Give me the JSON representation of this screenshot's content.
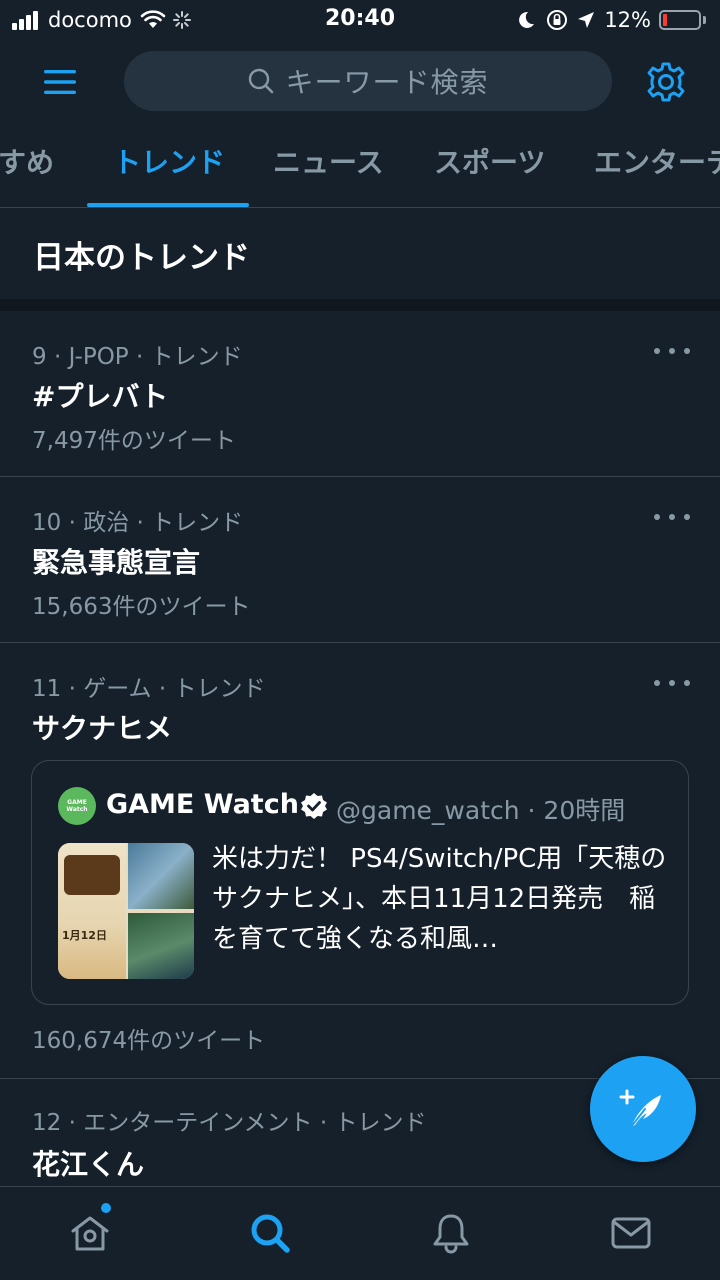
{
  "status_bar": {
    "carrier": "docomo",
    "time": "20:40",
    "battery_percent": "12%",
    "battery_level": 0.12,
    "icons": [
      "signal-icon",
      "wifi-icon",
      "activity-spinner-icon",
      "moon-icon",
      "rotation-lock-icon",
      "location-icon",
      "battery-icon"
    ]
  },
  "search": {
    "placeholder": "キーワード検索"
  },
  "tabs": [
    {
      "label": "すめ",
      "active": false
    },
    {
      "label": "トレンド",
      "active": true
    },
    {
      "label": "ニュース",
      "active": false
    },
    {
      "label": "スポーツ",
      "active": false
    },
    {
      "label": "エンターテ",
      "active": false
    }
  ],
  "section": {
    "title": "日本のトレンド"
  },
  "trends": [
    {
      "meta": "9 · J-POP · トレンド",
      "name": "#プレバト",
      "count": "7,497件のツイート"
    },
    {
      "meta": "10 · 政治 · トレンド",
      "name": "緊急事態宣言",
      "count": "15,663件のツイート"
    },
    {
      "meta": "11 · ゲーム · トレンド",
      "name": "サクナヒメ",
      "count": "160,674件のツイート"
    },
    {
      "meta": "12 · エンターテインメント · トレンド",
      "name": "花江くん"
    }
  ],
  "tweet_card": {
    "account_name": "GAME Watch",
    "handle_time": "@game_watch · 20時間",
    "avatar_text": "GAME Watch",
    "text": "米は力だ！ PS4/Switch/PC用「天穂のサクナヒメ」、本日11月12日発売　稲を育てて強くなる和風…",
    "thumb_date": "1月12日"
  },
  "colors": {
    "background": "#15202b",
    "accent": "#1da1f2",
    "secondary_text": "#8899a6",
    "border": "#38444d"
  },
  "bottom_nav": {
    "items": [
      "home-icon",
      "search-icon",
      "notifications-icon",
      "messages-icon"
    ],
    "active": "search-icon"
  }
}
